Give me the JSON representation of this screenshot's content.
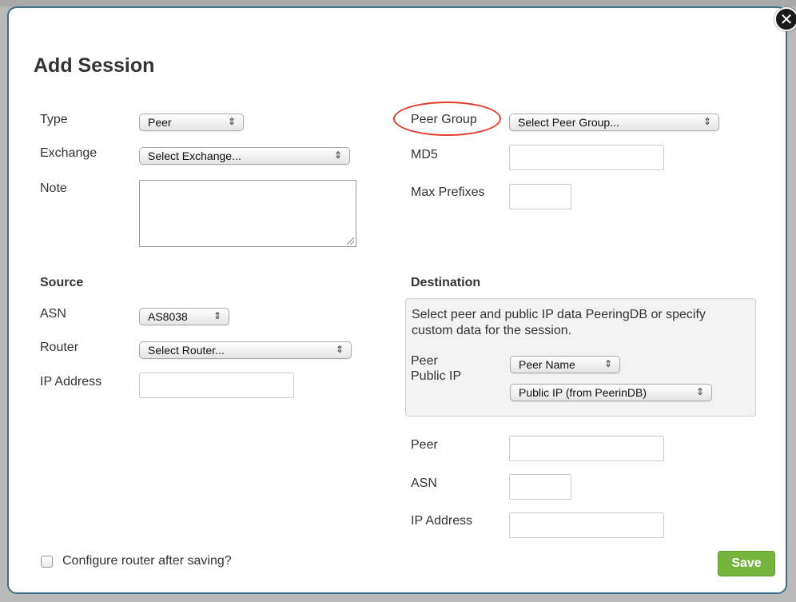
{
  "dialog": {
    "title": "Add Session",
    "close_label": "✕"
  },
  "left": {
    "type_label": "Type",
    "type_value": "Peer",
    "exchange_label": "Exchange",
    "exchange_value": "Select Exchange...",
    "note_label": "Note",
    "note_value": ""
  },
  "right": {
    "peer_group_label": "Peer Group",
    "peer_group_value": "Select Peer Group...",
    "md5_label": "MD5",
    "md5_value": "",
    "max_prefixes_label": "Max Prefixes",
    "max_prefixes_value": ""
  },
  "source": {
    "heading": "Source",
    "asn_label": "ASN",
    "asn_value": "AS8038",
    "router_label": "Router",
    "router_value": "Select Router...",
    "ip_label": "IP Address",
    "ip_value": ""
  },
  "destination": {
    "heading": "Destination",
    "info_text": "Select peer and public IP data PeeringDB or specify custom data for the session.",
    "peer_label": "Peer",
    "public_ip_label": "Public IP",
    "peer_name_value": "Peer Name",
    "public_ip_value": "Public IP (from PeerinDB)",
    "peer_field_label": "Peer",
    "peer_field_value": "",
    "asn_label": "ASN",
    "asn_value": "",
    "ip_label": "IP Address",
    "ip_value": ""
  },
  "footer": {
    "configure_label": "Configure router after saving?",
    "configure_checked": false,
    "save_label": "Save"
  },
  "icons": {
    "select_arrow": "select-arrow-icon",
    "close": "close-icon",
    "resize": "resize-grip-icon"
  },
  "colors": {
    "modal_border": "#3f6f88",
    "save_button": "#76b53d",
    "highlight": "#e53b2a",
    "info_box": "#f3f3f3"
  }
}
